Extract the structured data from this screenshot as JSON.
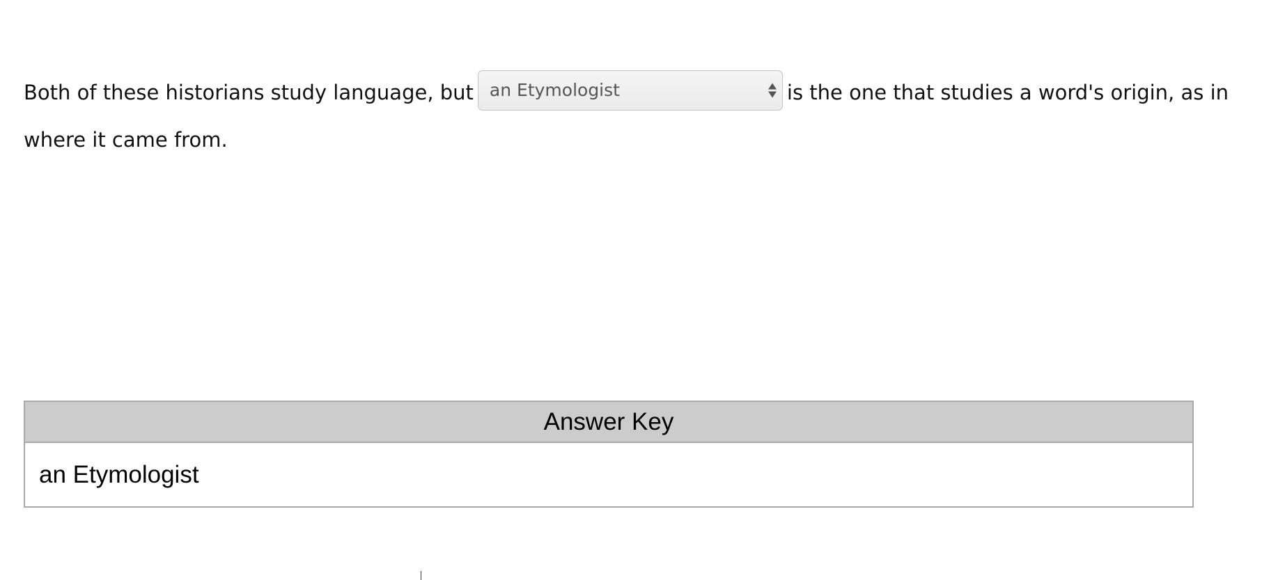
{
  "question": {
    "text_before": "Both of these historians study language, but",
    "dropdown": {
      "selected": "an Etymologist",
      "icon": "up-down-arrows-icon"
    },
    "text_after": "is the one that studies a word's origin, as in where it came from."
  },
  "answer_key": {
    "title": "Answer Key",
    "answer": "an Etymologist"
  },
  "colors": {
    "header_bg": "#cccccc",
    "border": "#a9a9a9",
    "select_bg": "#efefef",
    "select_text": "#555555"
  }
}
